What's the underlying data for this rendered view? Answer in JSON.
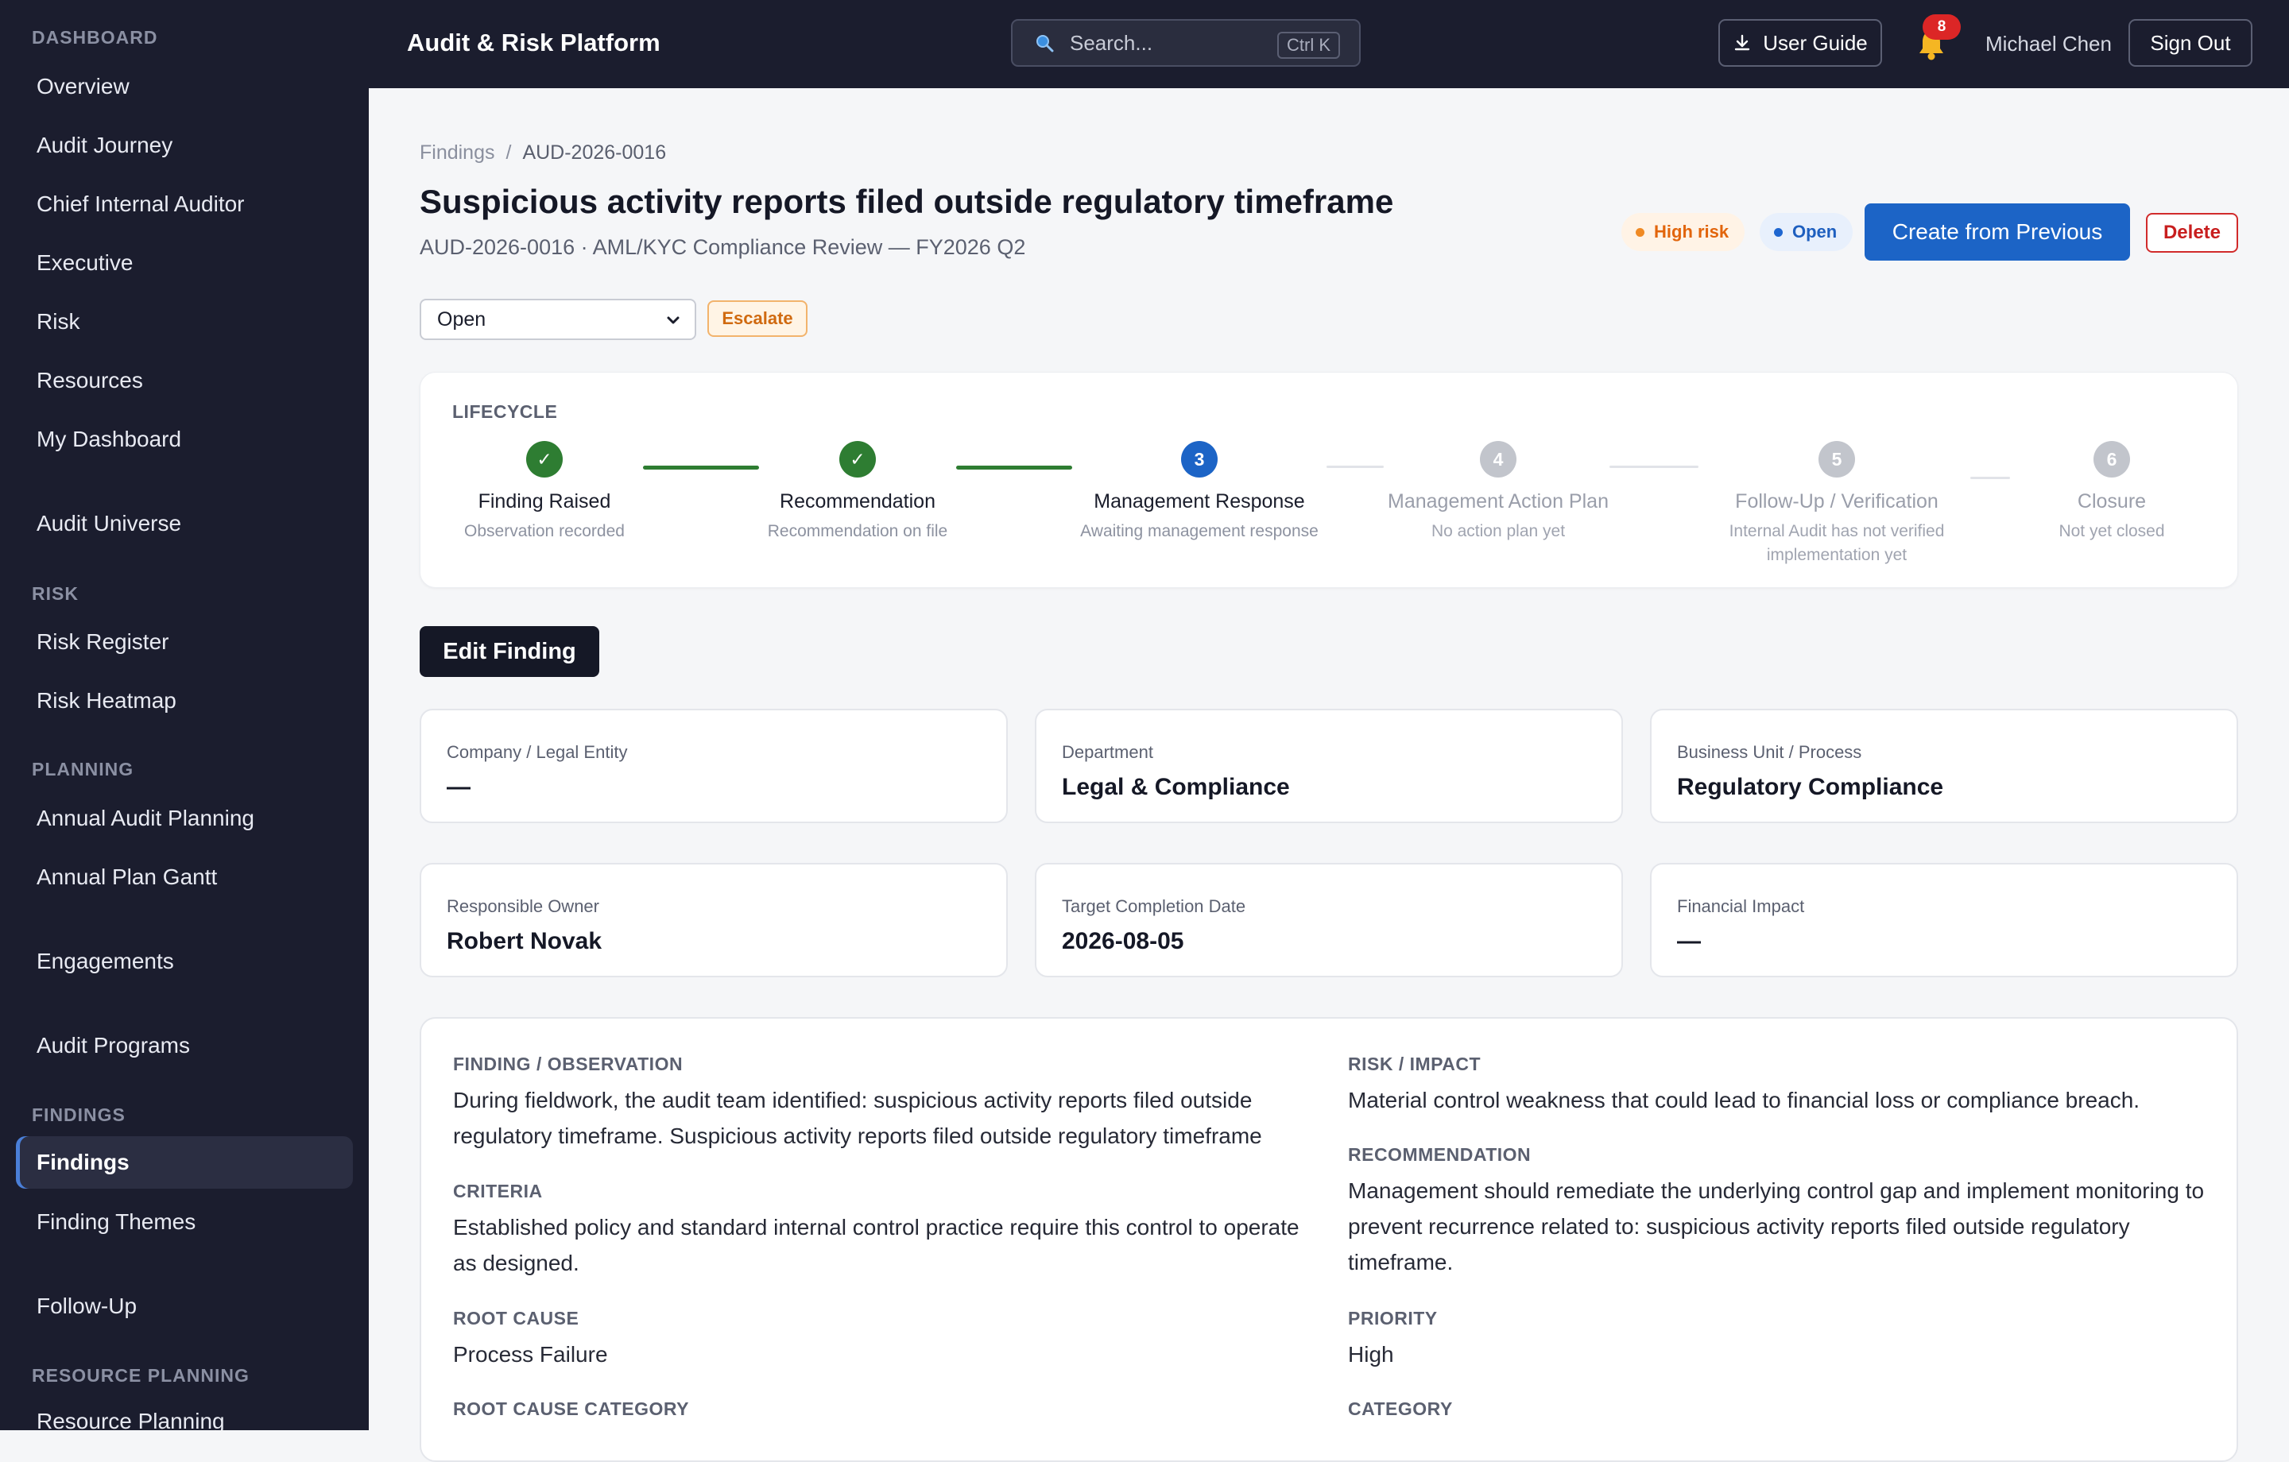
{
  "sidebar": {
    "sections": {
      "dashboard": "DASHBOARD",
      "risk": "RISK",
      "planning": "PLANNING",
      "findings": "FINDINGS",
      "resource_planning": "RESOURCE PLANNING"
    },
    "items": [
      {
        "label": "Overview"
      },
      {
        "label": "Audit Journey"
      },
      {
        "label": "Chief Internal Auditor"
      },
      {
        "label": "Executive"
      },
      {
        "label": "Risk"
      },
      {
        "label": "Resources"
      },
      {
        "label": "My Dashboard"
      },
      {
        "label": "Audit Universe"
      },
      {
        "label": "Risk Register"
      },
      {
        "label": "Risk Heatmap"
      },
      {
        "label": "Annual Audit Planning"
      },
      {
        "label": "Annual Plan Gantt"
      },
      {
        "label": "Engagements"
      },
      {
        "label": "Audit Programs"
      },
      {
        "label": "Findings"
      },
      {
        "label": "Finding Themes"
      },
      {
        "label": "Follow-Up"
      },
      {
        "label": "Resource Planning"
      }
    ],
    "active_item": "Findings"
  },
  "topbar": {
    "app_title": "Audit & Risk Platform",
    "search_placeholder": "Search...",
    "search_shortcut": "Ctrl K",
    "user_guide_label": "User Guide",
    "notification_count": "8",
    "user_name": "Michael Chen",
    "sign_out_label": "Sign Out"
  },
  "breadcrumb": {
    "parent": "Findings",
    "separator": "/",
    "current": "AUD-2026-0016"
  },
  "finding": {
    "title": "Suspicious activity reports filed outside regulatory timeframe",
    "subtitle": "AUD-2026-0016 · AML/KYC Compliance Review — FY2026 Q2",
    "risk_badge": "High risk",
    "status_badge": "Open",
    "create_from_previous_label": "Create from Previous",
    "delete_label": "Delete",
    "status_select_value": "Open",
    "escalate_label": "Escalate",
    "edit_label": "Edit Finding"
  },
  "lifecycle": {
    "label": "LIFECYCLE",
    "steps": [
      {
        "marker": "✓",
        "title": "Finding Raised",
        "desc": "Observation recorded",
        "state": "done"
      },
      {
        "marker": "✓",
        "title": "Recommendation",
        "desc": "Recommendation on file",
        "state": "done"
      },
      {
        "marker": "3",
        "title": "Management Response",
        "desc": "Awaiting management response",
        "state": "current"
      },
      {
        "marker": "4",
        "title": "Management Action Plan",
        "desc": "No action plan yet",
        "state": "pending"
      },
      {
        "marker": "5",
        "title": "Follow-Up / Verification",
        "desc": "Internal Audit has not verified implementation yet",
        "state": "pending"
      },
      {
        "marker": "6",
        "title": "Closure",
        "desc": "Not yet closed",
        "state": "pending"
      }
    ]
  },
  "info_cards": [
    {
      "label": "Company / Legal Entity",
      "value": "—"
    },
    {
      "label": "Department",
      "value": "Legal & Compliance"
    },
    {
      "label": "Business Unit / Process",
      "value": "Regulatory Compliance"
    },
    {
      "label": "Responsible Owner",
      "value": "Robert Novak"
    },
    {
      "label": "Target Completion Date",
      "value": "2026-08-05"
    },
    {
      "label": "Financial Impact",
      "value": "—"
    }
  ],
  "details": {
    "observation_heading": "FINDING / OBSERVATION",
    "observation": "During fieldwork, the audit team identified: suspicious activity reports filed outside regulatory timeframe. Suspicious activity reports filed outside regulatory timeframe",
    "criteria_heading": "CRITERIA",
    "criteria": "Established policy and standard internal control practice require this control to operate as designed.",
    "root_cause_heading": "ROOT CAUSE",
    "root_cause": "Process Failure",
    "root_cause_category_heading": "ROOT CAUSE CATEGORY",
    "risk_impact_heading": "RISK / IMPACT",
    "risk_impact": "Material control weakness that could lead to financial loss or compliance breach.",
    "recommendation_heading": "RECOMMENDATION",
    "recommendation": "Management should remediate the underlying control gap and implement monitoring to prevent recurrence related to: suspicious activity reports filed outside regulatory timeframe.",
    "priority_heading": "PRIORITY",
    "priority": "High",
    "category_heading": "CATEGORY"
  },
  "colors": {
    "sidebar_bg": "#1b1d2e",
    "primary": "#1c64c6",
    "success": "#2e7d32",
    "danger": "#c81e1e",
    "warning": "#e2650c"
  }
}
